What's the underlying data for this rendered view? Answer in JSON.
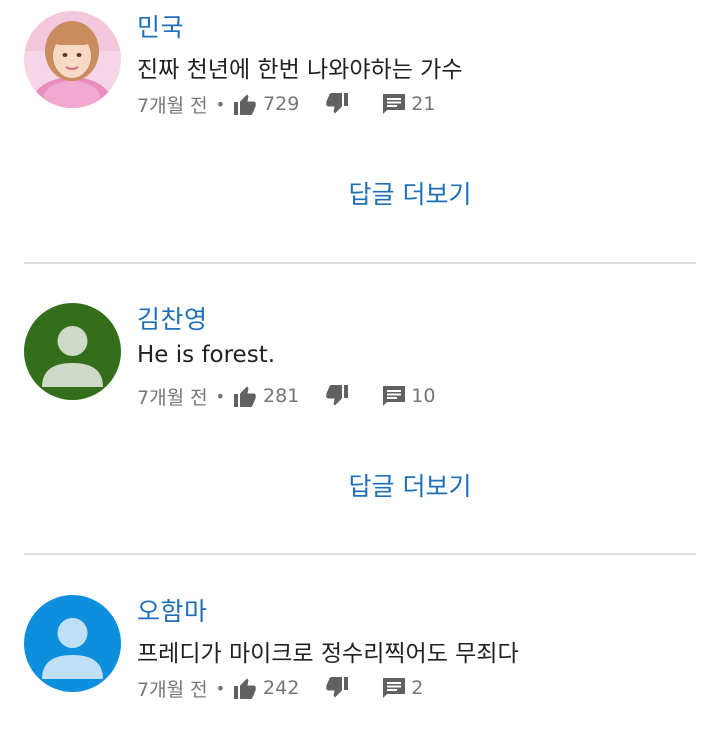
{
  "comments": [
    {
      "author": "민국",
      "text": "진짜 천년에 한번 나와야하는 가수",
      "time": "7개월 전",
      "dot": "•",
      "likes": "729",
      "replies": "21",
      "more_replies_label": "답글 더보기",
      "avatar": "photo-avatar"
    },
    {
      "author": "김찬영",
      "text": "He is forest.",
      "time": "7개월 전",
      "dot": "•",
      "likes": "281",
      "replies": "10",
      "more_replies_label": "답글 더보기",
      "avatar": "default-avatar",
      "avatar_bg": "#336e1a",
      "avatar_fg": "#cfd9c8"
    },
    {
      "author": "오함마",
      "text": "프레디가 마이크로 정수리찍어도 무죄다",
      "time": "7개월 전",
      "dot": "•",
      "likes": "242",
      "replies": "2",
      "avatar": "default-avatar",
      "avatar_bg": "#0d8fde",
      "avatar_fg": "#bfe0f5"
    }
  ],
  "icons": {
    "like": "thumb-up-icon",
    "dislike": "thumb-down-icon",
    "reply": "comment-icon"
  },
  "colors": {
    "link": "#1e6fb8",
    "meta": "#757575",
    "divider": "#dddddd"
  }
}
